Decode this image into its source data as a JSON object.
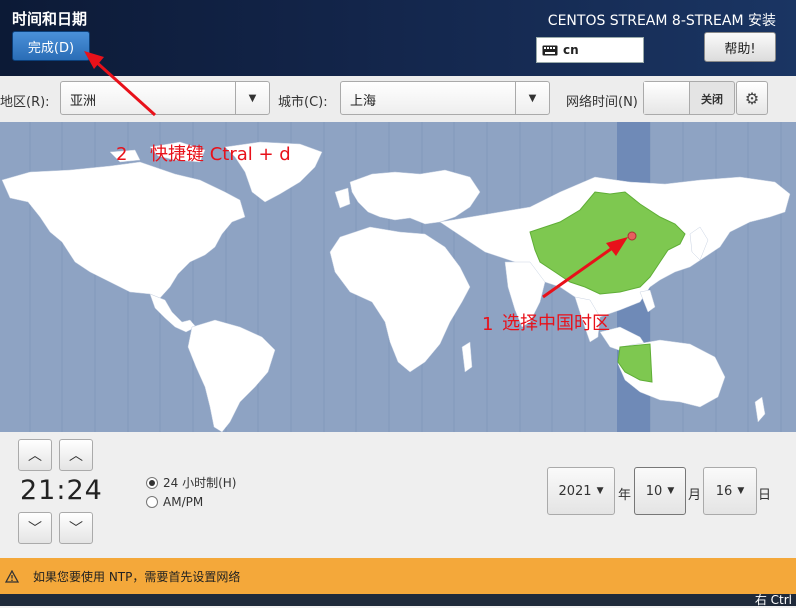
{
  "header": {
    "page_title": "时间和日期",
    "done_label": "完成(D)",
    "product_title": "CENTOS STREAM 8-STREAM 安装",
    "keyboard_layout": "cn",
    "help_label": "帮助!"
  },
  "toolbar": {
    "region_label": "地区(R):",
    "region_value": "亚洲",
    "city_label": "城市(C):",
    "city_value": "上海",
    "network_time_label": "网络时间(N)",
    "network_time_state": "关闭"
  },
  "map": {
    "highlight_color": "#7ec850",
    "ocean_color": "#8ea3c3",
    "zone_band_color": "#6f8ab7"
  },
  "time": {
    "display": "21:24",
    "format_24h_label": "24 小时制(H)",
    "format_ampm_label": "AM/PM",
    "selected_format": "24h"
  },
  "date": {
    "year": "2021",
    "year_unit": "年",
    "month": "10",
    "month_unit": "月",
    "day": "16",
    "day_unit": "日"
  },
  "warning": {
    "text": "如果您要使用 NTP，需要首先设置网络"
  },
  "taskbar": {
    "text": "右 Ctrl"
  },
  "annotations": {
    "num1": "1",
    "text1": "选择中国时区",
    "num2": "2",
    "text2": "快捷键 Ctral + d",
    "color": "#e8111a"
  }
}
